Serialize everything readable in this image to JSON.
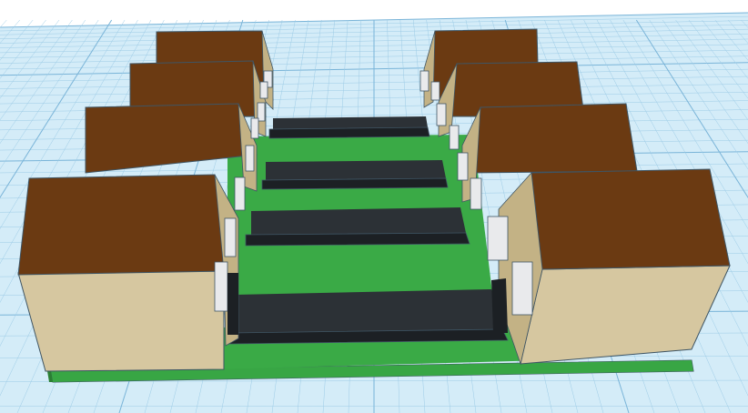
{
  "viewport": {
    "label": "",
    "colors": {
      "background": "#ffffff",
      "grid_fill": "#d4ecf8",
      "grid_line": "#9ccbe6",
      "grid_major": "#79b4d8",
      "base_green": "#3aaa46",
      "roof": "#6b3a12",
      "wall": "#d6c7a0",
      "wall_shade": "#c3b285",
      "road": "#24282c",
      "window": "#e9eaec",
      "outline": "#3f5564"
    }
  },
  "scene": {
    "left_row_houses": 4,
    "right_row_houses": 4,
    "road_strips": 4,
    "grass_strips": 4
  }
}
